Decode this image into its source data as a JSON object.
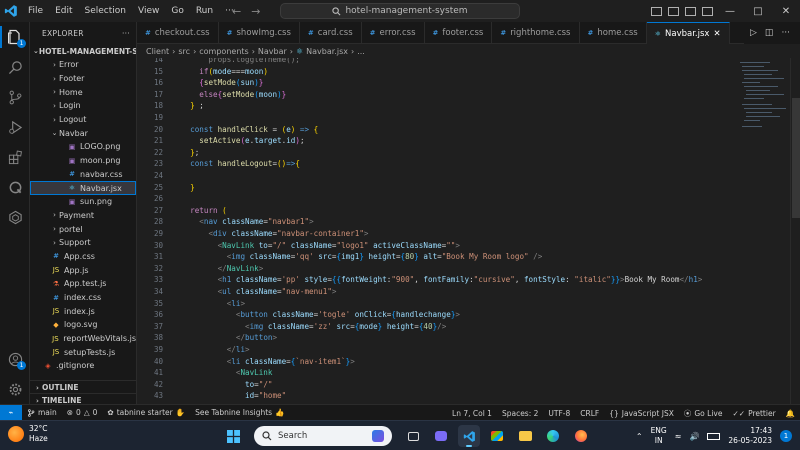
{
  "titlebar": {
    "menu": [
      "File",
      "Edit",
      "Selection",
      "View",
      "Go",
      "Run",
      "···"
    ],
    "search_text": "hotel-management-system"
  },
  "activity": {
    "explorer_badge": "1",
    "account_badge": "1"
  },
  "sidebar": {
    "header": "EXPLORER",
    "folder": "HOTEL-MANAGEMENT-SY...",
    "outline": "OUTLINE",
    "timeline": "TIMELINE",
    "items": [
      {
        "label": "Error",
        "kind": "folder",
        "depth": 2
      },
      {
        "label": "Footer",
        "kind": "folder",
        "depth": 2
      },
      {
        "label": "Home",
        "kind": "folder",
        "depth": 2
      },
      {
        "label": "Login",
        "kind": "folder",
        "depth": 2
      },
      {
        "label": "Logout",
        "kind": "folder",
        "depth": 2
      },
      {
        "label": "Navbar",
        "kind": "folder-open",
        "depth": 2
      },
      {
        "label": "LOGO.png",
        "kind": "image",
        "depth": 3
      },
      {
        "label": "moon.png",
        "kind": "image",
        "depth": 3
      },
      {
        "label": "navbar.css",
        "kind": "css",
        "depth": 3
      },
      {
        "label": "Navbar.jsx",
        "kind": "react",
        "depth": 3,
        "selected": true
      },
      {
        "label": "sun.png",
        "kind": "image",
        "depth": 3
      },
      {
        "label": "Payment",
        "kind": "folder",
        "depth": 2
      },
      {
        "label": "portel",
        "kind": "folder",
        "depth": 2
      },
      {
        "label": "Support",
        "kind": "folder",
        "depth": 2
      },
      {
        "label": "App.css",
        "kind": "css",
        "depth": 1
      },
      {
        "label": "App.js",
        "kind": "js",
        "depth": 1
      },
      {
        "label": "App.test.js",
        "kind": "test",
        "depth": 1
      },
      {
        "label": "index.css",
        "kind": "css",
        "depth": 1
      },
      {
        "label": "index.js",
        "kind": "js",
        "depth": 1
      },
      {
        "label": "logo.svg",
        "kind": "svg",
        "depth": 1
      },
      {
        "label": "reportWebVitals.js",
        "kind": "js",
        "depth": 1
      },
      {
        "label": "setupTests.js",
        "kind": "js",
        "depth": 1
      },
      {
        "label": ".gitignore",
        "kind": "git",
        "depth": 0
      }
    ]
  },
  "tabs": [
    {
      "label": "checkout.css",
      "kind": "css"
    },
    {
      "label": "showImg.css",
      "kind": "css"
    },
    {
      "label": "card.css",
      "kind": "css"
    },
    {
      "label": "error.css",
      "kind": "css"
    },
    {
      "label": "footer.css",
      "kind": "css"
    },
    {
      "label": "righthome.css",
      "kind": "css"
    },
    {
      "label": "home.css",
      "kind": "css"
    },
    {
      "label": "Navbar.jsx",
      "kind": "react",
      "active": true
    }
  ],
  "breadcrumb": [
    "Client",
    "src",
    "components",
    "Navbar",
    "Navbar.jsx",
    "..."
  ],
  "editor": {
    "first_line": 14,
    "lines": [
      [
        [
          "g",
          "      props.toggleTheme();"
        ]
      ],
      [
        [
          "t",
          "    "
        ],
        [
          "kw",
          "if"
        ],
        [
          "y",
          "("
        ],
        [
          "v",
          "mode"
        ],
        [
          "",
          "==="
        ],
        [
          "v",
          "moon"
        ],
        [
          "y",
          ")"
        ]
      ],
      [
        [
          "",
          "    "
        ],
        [
          "p",
          "{"
        ],
        [
          "f",
          "setMode"
        ],
        [
          "b",
          "("
        ],
        [
          "v",
          "sun"
        ],
        [
          "b",
          ")"
        ],
        [
          "p",
          "}"
        ]
      ],
      [
        [
          "",
          "    "
        ],
        [
          "kw",
          "else"
        ],
        [
          "p",
          "{"
        ],
        [
          "f",
          "setMode"
        ],
        [
          "b",
          "("
        ],
        [
          "v",
          "moon"
        ],
        [
          "b",
          ")"
        ],
        [
          "p",
          "}"
        ]
      ],
      [
        [
          "",
          "  "
        ],
        [
          "y",
          "}"
        ],
        [
          "",
          " ;"
        ]
      ],
      [
        [
          "",
          ""
        ]
      ],
      [
        [
          "",
          "  "
        ],
        [
          "k",
          "const "
        ],
        [
          "f",
          "handleClick"
        ],
        [
          "",
          " = "
        ],
        [
          "y",
          "("
        ],
        [
          "v",
          "e"
        ],
        [
          "y",
          ")"
        ],
        [
          "",
          " "
        ],
        [
          "k",
          "=>"
        ],
        [
          "",
          " "
        ],
        [
          "y",
          "{"
        ]
      ],
      [
        [
          "",
          "    "
        ],
        [
          "f",
          "setActive"
        ],
        [
          "p",
          "("
        ],
        [
          "v",
          "e"
        ],
        [
          "",
          "."
        ],
        [
          "v",
          "target"
        ],
        [
          "",
          "."
        ],
        [
          "v",
          "id"
        ],
        [
          "p",
          ")"
        ],
        [
          ";",
          ";"
        ]
      ],
      [
        [
          "",
          "  "
        ],
        [
          "y",
          "}"
        ],
        [
          ";",
          ";"
        ]
      ],
      [
        [
          "",
          "  "
        ],
        [
          "k",
          "const "
        ],
        [
          "f",
          "handleLogout"
        ],
        [
          "",
          "="
        ],
        [
          "y",
          "()"
        ],
        [
          "k",
          "=>"
        ],
        [
          "y",
          "{"
        ]
      ],
      [
        [
          "",
          ""
        ]
      ],
      [
        [
          "",
          "  "
        ],
        [
          "y",
          "}"
        ]
      ],
      [
        [
          "",
          ""
        ]
      ],
      [
        [
          "",
          "  "
        ],
        [
          "kw",
          "return"
        ],
        [
          "",
          " "
        ],
        [
          "y",
          "("
        ]
      ],
      [
        [
          "",
          "    "
        ],
        [
          "g",
          "<"
        ],
        [
          "k",
          "nav "
        ],
        [
          "v",
          "className"
        ],
        [
          "",
          "="
        ],
        [
          "s",
          "\"navbar1\""
        ],
        [
          "g",
          ">"
        ]
      ],
      [
        [
          "",
          "      "
        ],
        [
          "g",
          "<"
        ],
        [
          "k",
          "div "
        ],
        [
          "v",
          "className"
        ],
        [
          "",
          "="
        ],
        [
          "s",
          "\"navbar-container1\""
        ],
        [
          "g",
          ">"
        ]
      ],
      [
        [
          "",
          "        "
        ],
        [
          "g",
          "<"
        ],
        [
          "t",
          "NavLink "
        ],
        [
          "v",
          "to"
        ],
        [
          "",
          "="
        ],
        [
          "s",
          "\"/\" "
        ],
        [
          "v",
          "className"
        ],
        [
          "",
          "="
        ],
        [
          "s",
          "\"logo1\" "
        ],
        [
          "v",
          "activeClassName"
        ],
        [
          "",
          "="
        ],
        [
          "s",
          "\"\""
        ],
        [
          "g",
          ">"
        ]
      ],
      [
        [
          "",
          "          "
        ],
        [
          "g",
          "<"
        ],
        [
          "k",
          "img "
        ],
        [
          "v",
          "className"
        ],
        [
          "",
          "="
        ],
        [
          "s",
          "'qq' "
        ],
        [
          "v",
          "src"
        ],
        [
          "",
          "="
        ],
        [
          "b",
          "{"
        ],
        [
          "v",
          "img1"
        ],
        [
          "b",
          "}"
        ],
        [
          "",
          " "
        ],
        [
          "v",
          "height"
        ],
        [
          "",
          "="
        ],
        [
          "b",
          "{"
        ],
        [
          "n",
          "80"
        ],
        [
          "b",
          "}"
        ],
        [
          "",
          " "
        ],
        [
          "v",
          "alt"
        ],
        [
          "",
          "="
        ],
        [
          "s",
          "\"Book My Room logo\""
        ],
        [
          "",
          " "
        ],
        [
          "g",
          "/>"
        ]
      ],
      [
        [
          "",
          "        "
        ],
        [
          "g",
          "</"
        ],
        [
          "t",
          "NavLink"
        ],
        [
          "g",
          ">"
        ]
      ],
      [
        [
          "",
          "        "
        ],
        [
          "g",
          "<"
        ],
        [
          "k",
          "h1 "
        ],
        [
          "v",
          "className"
        ],
        [
          "",
          "="
        ],
        [
          "s",
          "'pp' "
        ],
        [
          "v",
          "style"
        ],
        [
          "",
          "="
        ],
        [
          "b",
          "{{"
        ],
        [
          "v",
          "fontWeight"
        ],
        [
          "",
          ":"
        ],
        [
          "s",
          "\"900\""
        ],
        [
          "",
          ", "
        ],
        [
          "v",
          "fontFamily"
        ],
        [
          "",
          ":"
        ],
        [
          "s",
          "\"cursive\""
        ],
        [
          "",
          ", "
        ],
        [
          "v",
          "fontStyle"
        ],
        [
          "",
          ": "
        ],
        [
          "s",
          "\"italic\""
        ],
        [
          "b",
          "}}"
        ],
        [
          "g",
          ">"
        ],
        [
          "",
          "Book My Room"
        ],
        [
          "g",
          "</"
        ],
        [
          "k",
          "h1"
        ],
        [
          "g",
          ">"
        ]
      ],
      [
        [
          "",
          "        "
        ],
        [
          "g",
          "<"
        ],
        [
          "k",
          "ul "
        ],
        [
          "v",
          "className"
        ],
        [
          "",
          "="
        ],
        [
          "s",
          "\"nav-menu1\""
        ],
        [
          "g",
          ">"
        ]
      ],
      [
        [
          "",
          "          "
        ],
        [
          "g",
          "<"
        ],
        [
          "k",
          "li"
        ],
        [
          "g",
          ">"
        ]
      ],
      [
        [
          "",
          "            "
        ],
        [
          "g",
          "<"
        ],
        [
          "k",
          "button "
        ],
        [
          "v",
          "className"
        ],
        [
          "",
          "="
        ],
        [
          "s",
          "'togle' "
        ],
        [
          "v",
          "onClick"
        ],
        [
          "",
          "="
        ],
        [
          "b",
          "{"
        ],
        [
          "v",
          "handlechange"
        ],
        [
          "b",
          "}"
        ],
        [
          "g",
          ">"
        ]
      ],
      [
        [
          "",
          "              "
        ],
        [
          "g",
          "<"
        ],
        [
          "k",
          "img "
        ],
        [
          "v",
          "className"
        ],
        [
          "",
          "="
        ],
        [
          "s",
          "'zz' "
        ],
        [
          "v",
          "src"
        ],
        [
          "",
          "="
        ],
        [
          "b",
          "{"
        ],
        [
          "v",
          "mode"
        ],
        [
          "b",
          "}"
        ],
        [
          "",
          " "
        ],
        [
          "v",
          "height"
        ],
        [
          "",
          "="
        ],
        [
          "b",
          "{"
        ],
        [
          "n",
          "40"
        ],
        [
          "b",
          "}"
        ],
        [
          "g",
          "/>"
        ]
      ],
      [
        [
          "",
          "            "
        ],
        [
          "g",
          "</"
        ],
        [
          "k",
          "button"
        ],
        [
          "g",
          ">"
        ]
      ],
      [
        [
          "",
          "          "
        ],
        [
          "g",
          "</"
        ],
        [
          "k",
          "li"
        ],
        [
          "g",
          ">"
        ]
      ],
      [
        [
          "",
          "          "
        ],
        [
          "g",
          "<"
        ],
        [
          "k",
          "li "
        ],
        [
          "v",
          "className"
        ],
        [
          "",
          "="
        ],
        [
          "b",
          "{"
        ],
        [
          "s",
          "`nav-item1`"
        ],
        [
          "b",
          "}"
        ],
        [
          "g",
          ">"
        ]
      ],
      [
        [
          "",
          "            "
        ],
        [
          "g",
          "<"
        ],
        [
          "t",
          "NavLink"
        ]
      ],
      [
        [
          "",
          "              "
        ],
        [
          "v",
          "to"
        ],
        [
          "",
          "="
        ],
        [
          "s",
          "\"/\""
        ]
      ],
      [
        [
          "",
          "              "
        ],
        [
          "v",
          "id"
        ],
        [
          "",
          "="
        ],
        [
          "s",
          "\"home\""
        ]
      ]
    ]
  },
  "statusbar": {
    "remote": "⌁",
    "branch": "main",
    "errors": "0",
    "warnings": "0",
    "tabnine": "tabnine starter",
    "insights": "See Tabnine Insights",
    "position": "Ln 7, Col 1",
    "spaces": "Spaces: 2",
    "encoding": "UTF-8",
    "eol": "CRLF",
    "language": "JavaScript JSX",
    "golive": "Go Live",
    "prettier": "Prettier"
  },
  "taskbar": {
    "temp": "32°C",
    "condition": "Haze",
    "search_placeholder": "Search",
    "lang_top": "ENG",
    "lang_bottom": "IN",
    "time": "17:43",
    "date": "26-05-2023",
    "notif": "1"
  },
  "colors": {
    "accent": "#0078d4",
    "editor_bg": "#1f1f1f",
    "sidebar_bg": "#181818",
    "taskbar_bg": "#1c2431"
  }
}
